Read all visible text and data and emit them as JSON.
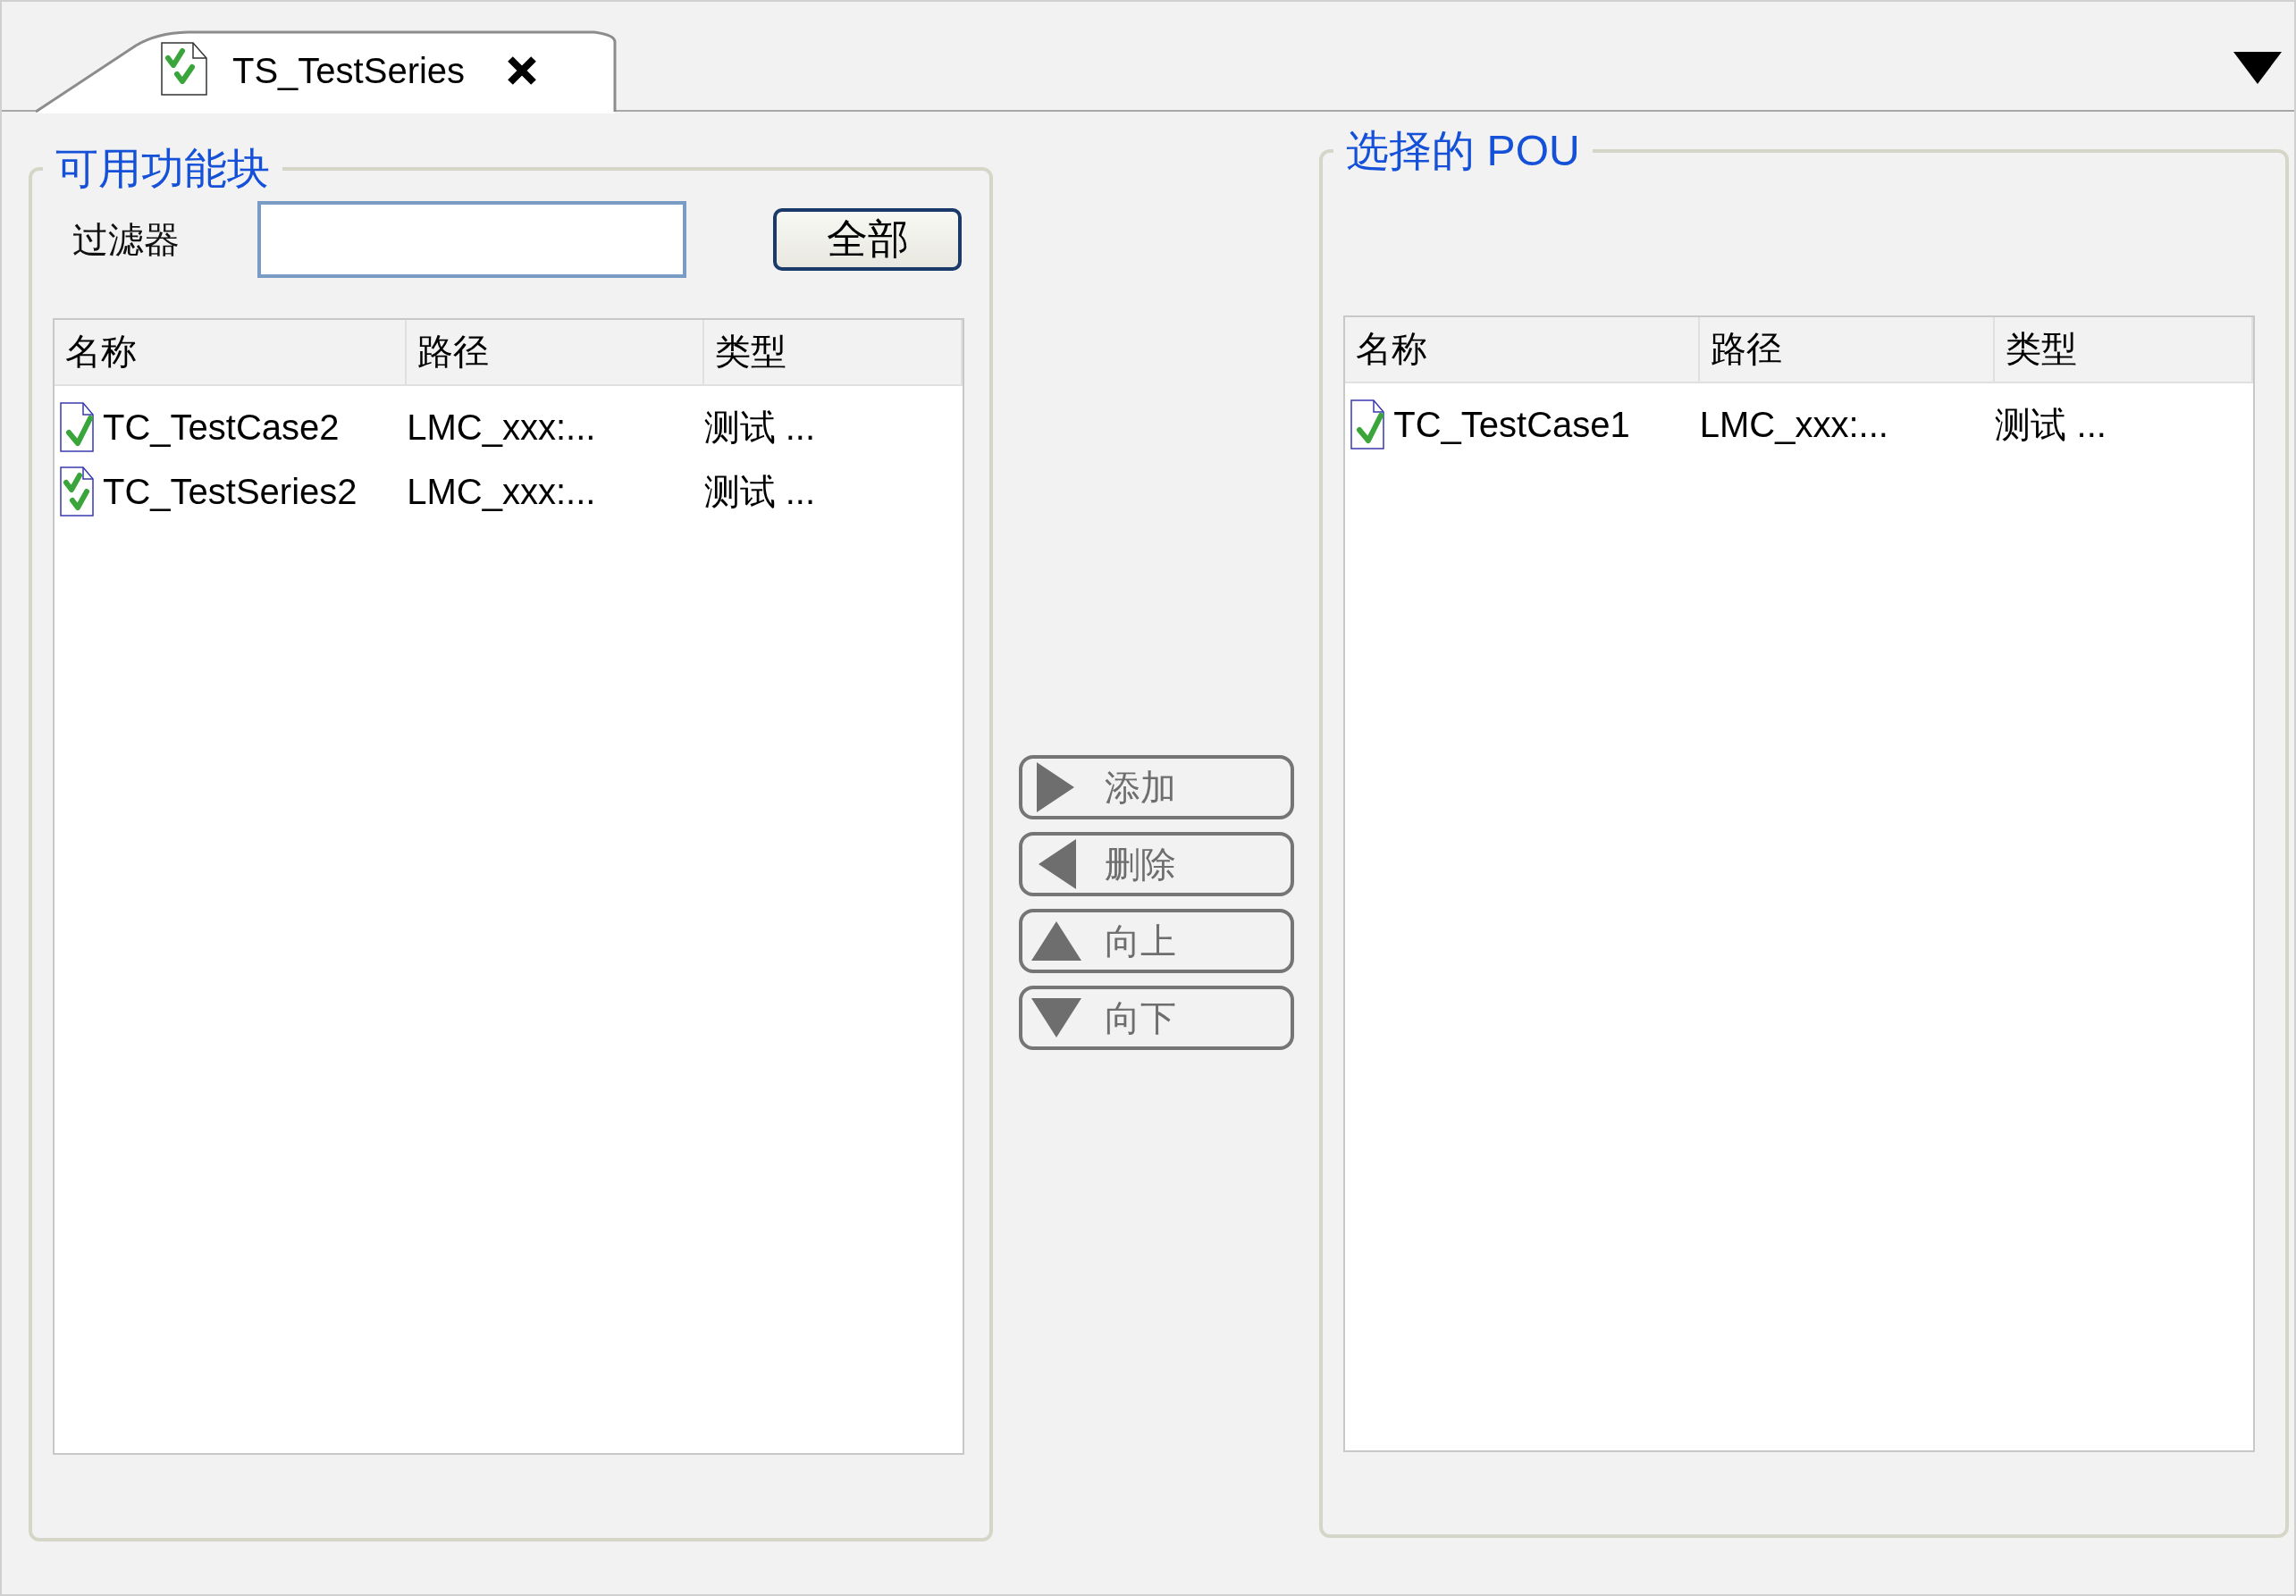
{
  "tabs": [
    {
      "label": "TS_TestSeries",
      "selected": true
    }
  ],
  "available": {
    "title": "可用功能块",
    "filter_label": "过滤器",
    "all_button": "全部",
    "columns": [
      "名称",
      "路径",
      "类型"
    ],
    "rows": [
      {
        "kind": "testcase",
        "name": "TC_TestCase2",
        "path": "LMC_xxx:...",
        "type": "测试 ..."
      },
      {
        "kind": "testseries",
        "name": "TC_TestSeries2",
        "path": "LMC_xxx:...",
        "type": "测试 ..."
      }
    ]
  },
  "actions": [
    {
      "kind": "right",
      "label": "添加"
    },
    {
      "kind": "left",
      "label": "删除"
    },
    {
      "kind": "up",
      "label": "向上"
    },
    {
      "kind": "down",
      "label": "向下"
    }
  ],
  "selected_pou": {
    "title": "选择的 POU",
    "columns": [
      "名称",
      "路径",
      "类型"
    ],
    "rows": [
      {
        "kind": "testcase",
        "name": "TC_TestCase1",
        "path": "LMC_xxx:...",
        "type": "测试 ..."
      }
    ]
  }
}
